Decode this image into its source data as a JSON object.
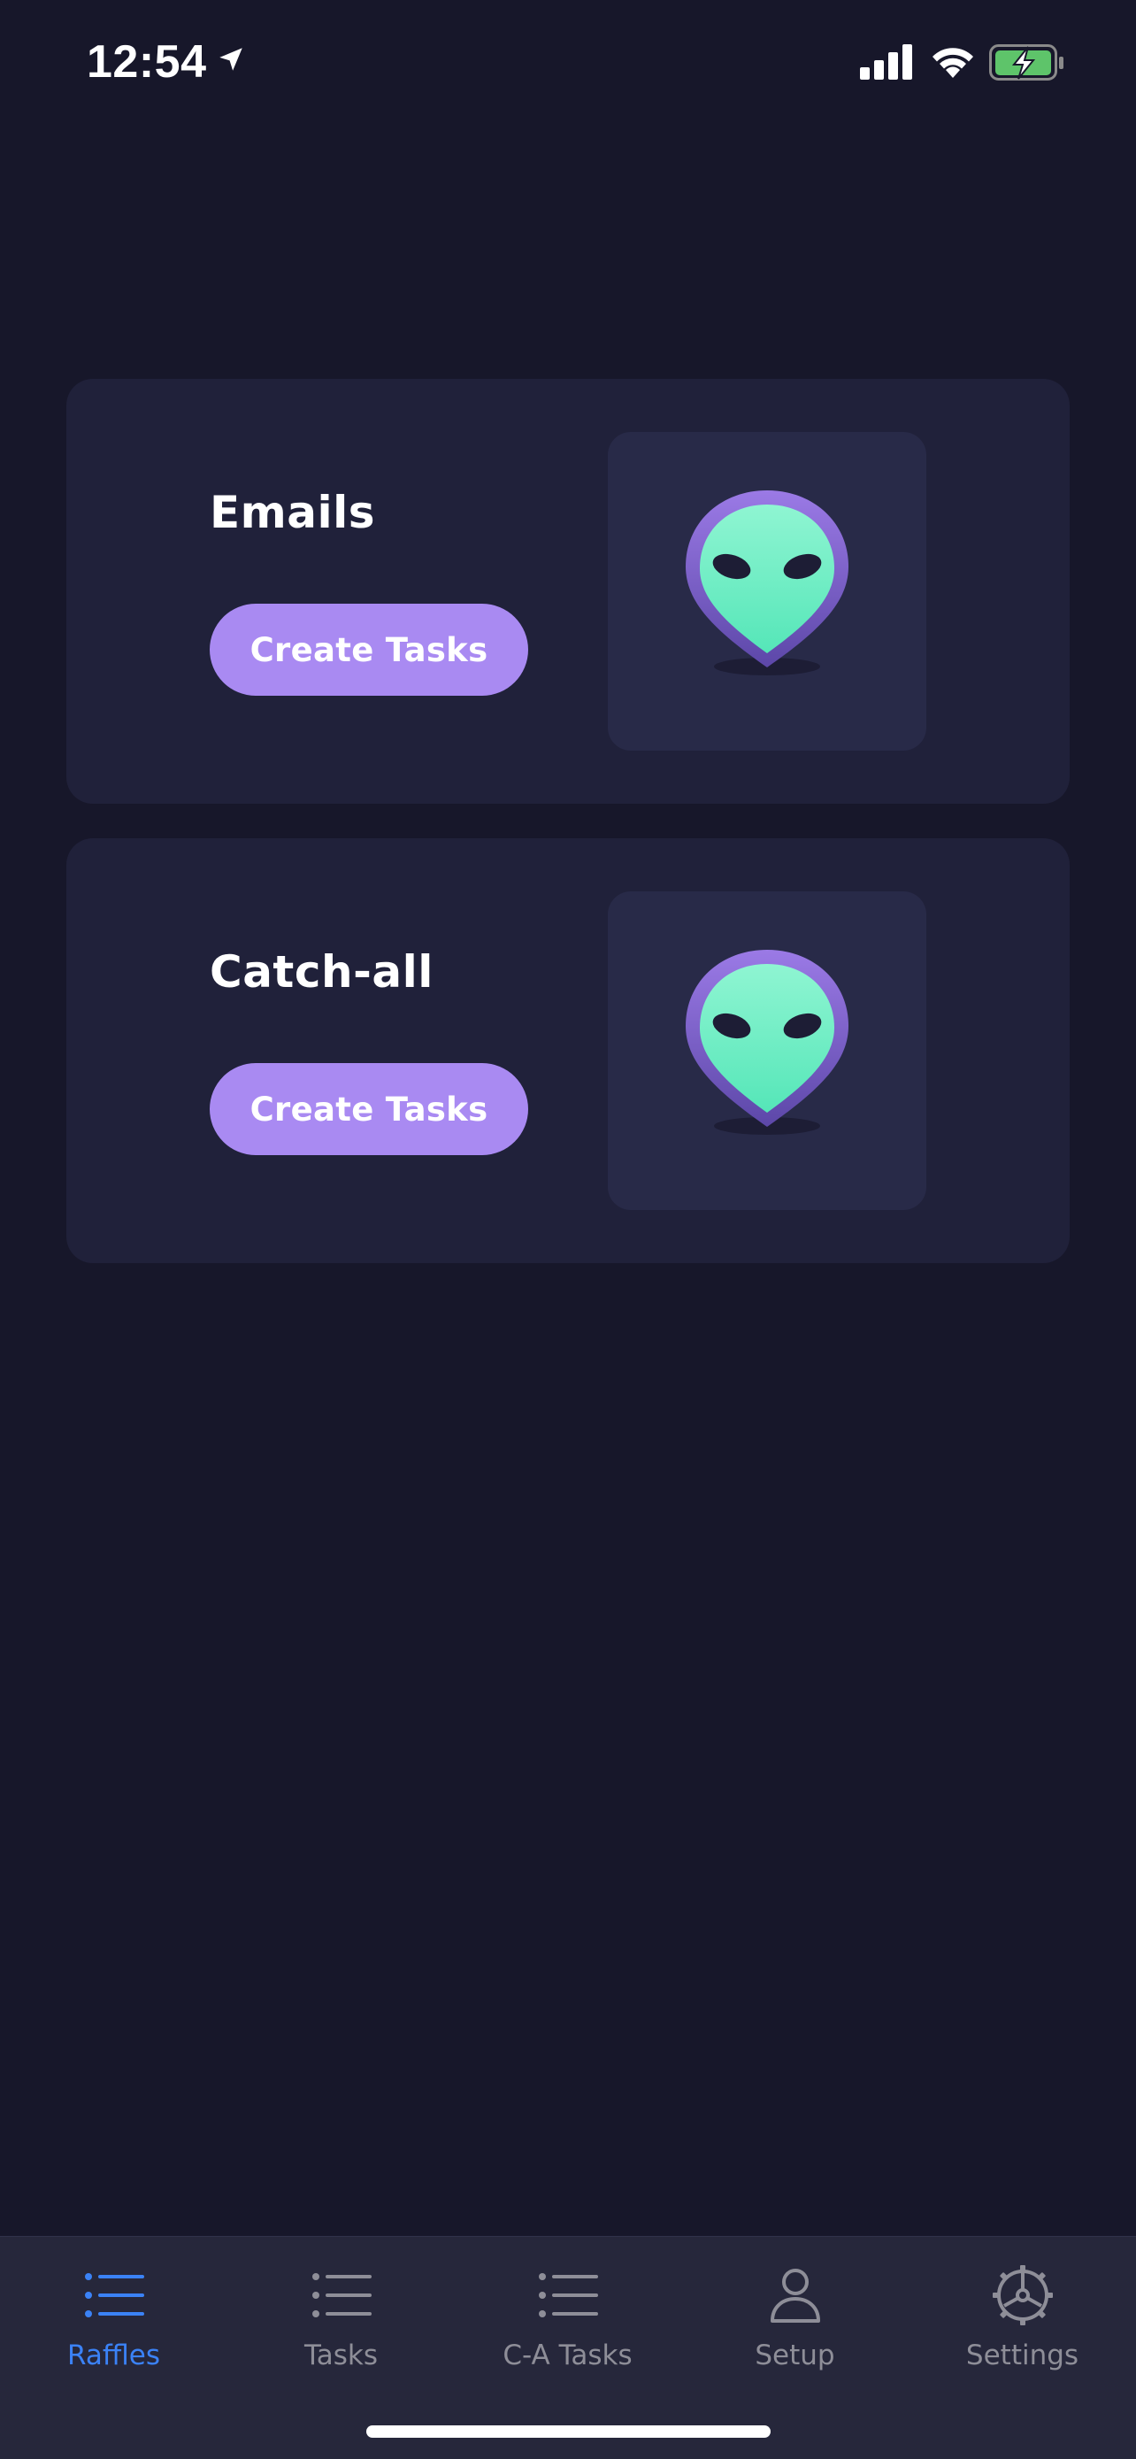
{
  "status_bar": {
    "time": "12:54",
    "icons": [
      "location-arrow-icon",
      "cellular-signal-icon",
      "wifi-icon",
      "battery-charging-icon"
    ],
    "battery_color": "#5ec46a"
  },
  "cards": [
    {
      "title": "Emails",
      "button_label": "Create Tasks",
      "icon": "alien-head-icon"
    },
    {
      "title": "Catch-all",
      "button_label": "Create Tasks",
      "icon": "alien-head-icon"
    }
  ],
  "tab_bar": {
    "active_color": "#3b82f6",
    "inactive_color": "#8e8e98",
    "tabs": [
      {
        "label": "Raffles",
        "icon": "list-icon",
        "active": true
      },
      {
        "label": "Tasks",
        "icon": "list-icon",
        "active": false
      },
      {
        "label": "C-A Tasks",
        "icon": "list-icon",
        "active": false
      },
      {
        "label": "Setup",
        "icon": "person-icon",
        "active": false
      },
      {
        "label": "Settings",
        "icon": "gear-icon",
        "active": false
      }
    ]
  },
  "colors": {
    "background": "#17172a",
    "card": "#20213a",
    "button": "#a98af2",
    "alien_green": "#6ef2c4",
    "alien_purple": "#8a6ad8"
  }
}
